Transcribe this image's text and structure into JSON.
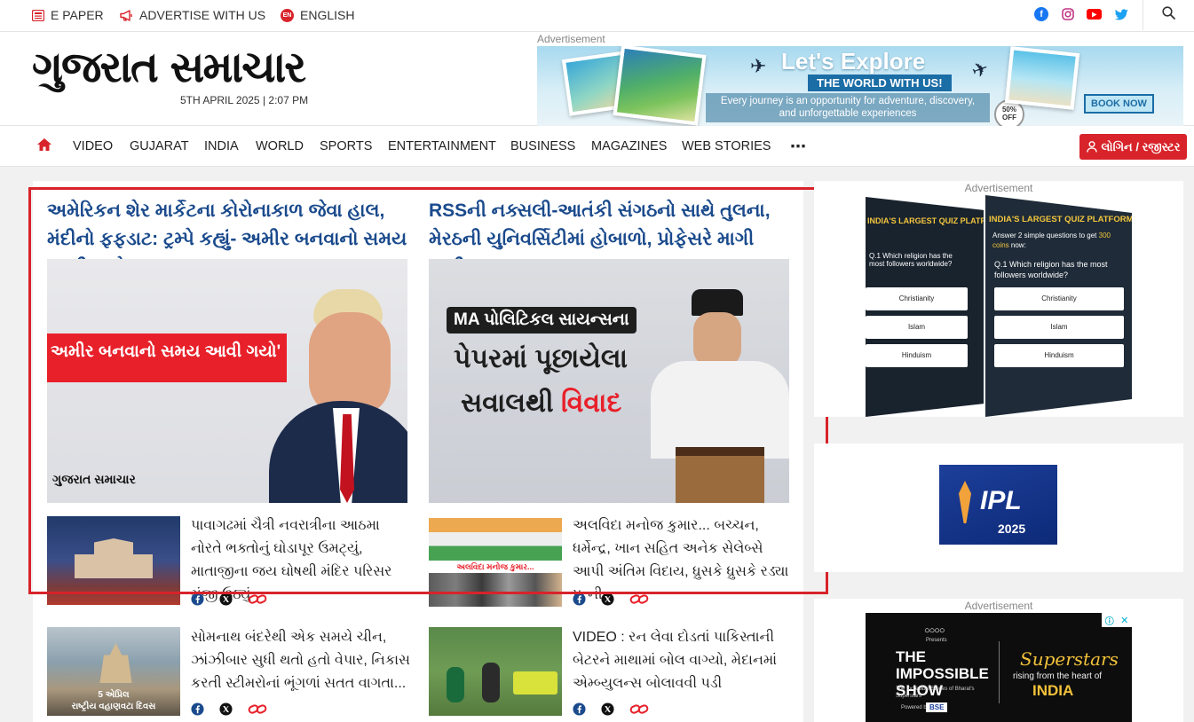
{
  "topbar": {
    "epaper": "E PAPER",
    "advertise": "ADVERTISE WITH US",
    "english": "ENGLISH",
    "english_badge": "EN",
    "social_icons": [
      "facebook-icon",
      "instagram-icon",
      "youtube-icon",
      "twitter-icon"
    ]
  },
  "header": {
    "logo": "ગુજરાત સમાચાર",
    "date": "5TH APRIL 2025 | 2:07 PM",
    "ad_label": "Advertisement",
    "banner": {
      "title": "Let's Explore",
      "subtitle": "THE WORLD WITH US!",
      "desc": "Every journey is an opportunity for adventure, discovery, and unforgettable experiences",
      "badge": "50% OFF",
      "button": "BOOK NOW"
    }
  },
  "nav": {
    "items": [
      "VIDEO",
      "GUJARAT",
      "INDIA",
      "WORLD",
      "SPORTS",
      "ENTERTAINMENT",
      "BUSINESS",
      "MAGAZINES",
      "WEB STORIES"
    ],
    "login": "લોગિન / રજીસ્ટર"
  },
  "leads": [
    {
      "title": "અમેરિકન શેર માર્કેટના કોરોનાકાળ જેવા હાલ, મંદીનો ફફડાટ: ટ્રમ્પે કહ્યું- અમીર બનવાનો સમય આવી ગયો",
      "img_caption": "અમીર બનવાનો સમય આવી ગયો'",
      "img_brand": "ગુજરાત સમાચાર"
    },
    {
      "title": "RSSની નક્સલી-આતંકી સંગઠનો સાથે તુલના, મેરઠની યુનિવર્સિટીમાં હોબાળો, પ્રોફેસરે માગી માફી",
      "img_line1": "MA પોલિટિકલ સાયન્સના",
      "img_line2": "પેપરમાં પૂછાયેલા",
      "img_line3a": "સવાલથી ",
      "img_line3b": "વિવાદ"
    }
  ],
  "stories": [
    {
      "text": "પાવાગઢમાં ચૈત્રી નવરાત્રીના આઠમા નોરતે ભક્તોનું ઘોડાપૂર ઉમટ્યું, માતાજીના જય ઘોષથી મંદિર પરિસર ગુંજી ઉઠ્યું"
    },
    {
      "text": "અલવિદા મનોજ કુમાર... બચ્ચન, ધર્મેન્દ્ર, ખાન સહિત અનેક સેલેબ્સે આપી અંતિમ વિદાય, ધ્રુસકે ધ્રુસકે રડ્યા પત્ની",
      "thumb_caption": "અલવિદા મનોજ કુમાર..."
    },
    {
      "text": "સોમનાથ બંદરેથી એક સમયે ચીન, ઝાંઝીબાર સુધી થતો હતો વેપાર, નિકાસ કરતી સ્ટીમરોનાં ભૂંગળાં સતત વાગતા...",
      "thumb_caption1": "5 એપ્રિલ",
      "thumb_caption2": "રાષ્ટ્રીય વહાણવટા દિવસ"
    },
    {
      "text": "VIDEO : રન લેવા દોડતાં પાકિસ્તાની બેટરને માથામાં બોલ વાગ્યો, મેદાનમાં એમ્બ્યુલન્સ બોલાવવી પડી"
    }
  ],
  "sidebar": {
    "ad_label": "Advertisement",
    "quiz": {
      "title": "INDIA'S LARGEST QUIZ PLATFORM",
      "intro_pre": "Answer 2 simple questions to get ",
      "intro_coins": "300 coins",
      "intro_post": " now:",
      "question": "Q.1 Which religion has the most followers worldwide?",
      "options": [
        "Christianity",
        "Islam",
        "Hinduism"
      ]
    },
    "ipl": {
      "label": "IPL",
      "year": "2025"
    },
    "ad2_label": "Advertisement",
    "impossible": {
      "show_title": "THE IMPOSSIBLE SHOW",
      "tagline": "The Incredible Stories of Bharat's Superstars",
      "superstars": "Superstars",
      "rising": "rising from the heart of",
      "india": "INDIA",
      "powered": "Powered by",
      "bse": "BSE",
      "presents": "Presents"
    }
  }
}
